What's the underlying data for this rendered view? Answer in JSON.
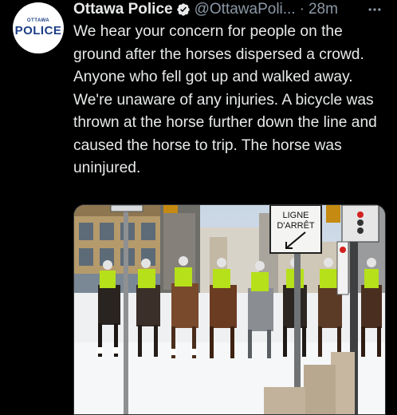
{
  "tweet": {
    "avatar": {
      "small": "OTTAWA",
      "big": "POLICE"
    },
    "author_name": "Ottawa Police",
    "handle": "@OttawaPoli...",
    "separator": "·",
    "time": "28m",
    "more_icon": "more-icon",
    "text": "We hear your concern for people on the ground after the horses dispersed a crowd. Anyone who fell got up and walked away. We're unaware of any injuries. A bicycle was thrown at the horse further down the line and caused the horse to trip. The horse was uninjured."
  },
  "media": {
    "sign_line1": "LIGNE",
    "sign_line2": "D'ARRÊT"
  },
  "colors": {
    "background": "#000000",
    "text": "#e7e9ea",
    "muted": "#8b98a5",
    "verified": "#1d9bf0"
  }
}
